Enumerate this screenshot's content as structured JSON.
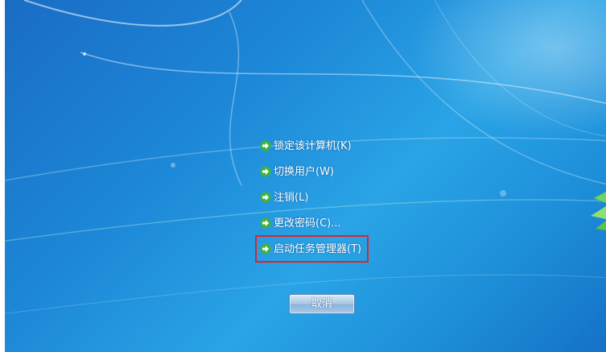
{
  "menu": {
    "items": [
      {
        "label": "锁定该计算机(K)",
        "icon": "green-arrow-icon"
      },
      {
        "label": "切换用户(W)",
        "icon": "green-arrow-icon"
      },
      {
        "label": "注销(L)",
        "icon": "green-arrow-icon"
      },
      {
        "label": "更改密码(C)...",
        "icon": "green-arrow-icon"
      },
      {
        "label": "启动任务管理器(T)",
        "icon": "green-arrow-icon"
      }
    ]
  },
  "cancel_button": {
    "label": "取消"
  },
  "colors": {
    "background": "#1d88d8",
    "highlight_border": "#d9262b",
    "arrow_green": "#3db33d",
    "text": "#ffffff"
  }
}
